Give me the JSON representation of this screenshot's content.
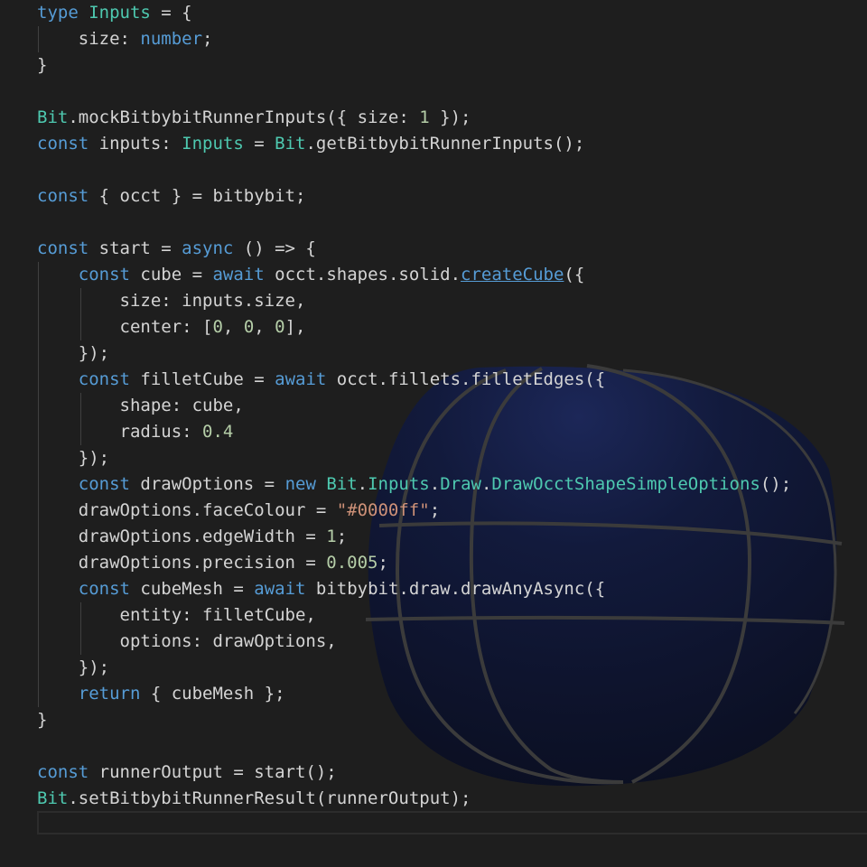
{
  "colors": {
    "background": "#1e1e1e",
    "keyword": "#569cd6",
    "type": "#4ec9b0",
    "number": "#b5cea8",
    "string": "#ce9178",
    "text": "#d4d4d4",
    "indent_guide": "#404040",
    "viewport_sphere": "#0e1330",
    "viewport_edges": "#3b3b3b"
  },
  "viewport": {
    "shape": "fillet-cube-wireframe"
  },
  "code": {
    "lines": [
      [
        [
          "kw",
          "type "
        ],
        [
          "type",
          "Inputs"
        ],
        [
          "plain",
          " = {"
        ]
      ],
      [
        [
          "plain",
          "    size: "
        ],
        [
          "kw",
          "number"
        ],
        [
          "plain",
          ";"
        ]
      ],
      [
        [
          "plain",
          "}"
        ]
      ],
      [],
      [
        [
          "type",
          "Bit"
        ],
        [
          "plain",
          ".mockBitbybitRunnerInputs({ size: "
        ],
        [
          "num",
          "1"
        ],
        [
          "plain",
          " });"
        ]
      ],
      [
        [
          "kw",
          "const "
        ],
        [
          "plain",
          "inputs: "
        ],
        [
          "type",
          "Inputs"
        ],
        [
          "plain",
          " = "
        ],
        [
          "type",
          "Bit"
        ],
        [
          "plain",
          ".getBitbybitRunnerInputs();"
        ]
      ],
      [],
      [
        [
          "kw",
          "const "
        ],
        [
          "plain",
          "{ occt } = bitbybit;"
        ]
      ],
      [],
      [
        [
          "kw",
          "const "
        ],
        [
          "plain",
          "start = "
        ],
        [
          "kw",
          "async"
        ],
        [
          "plain",
          " () => {"
        ]
      ],
      [
        [
          "plain",
          "    "
        ],
        [
          "kw",
          "const "
        ],
        [
          "plain",
          "cube = "
        ],
        [
          "kw",
          "await "
        ],
        [
          "plain",
          "occt.shapes.solid."
        ],
        [
          "link",
          "createCube"
        ],
        [
          "plain",
          "({"
        ]
      ],
      [
        [
          "plain",
          "        size: inputs.size,"
        ]
      ],
      [
        [
          "plain",
          "        center: ["
        ],
        [
          "num",
          "0"
        ],
        [
          "plain",
          ", "
        ],
        [
          "num",
          "0"
        ],
        [
          "plain",
          ", "
        ],
        [
          "num",
          "0"
        ],
        [
          "plain",
          "],"
        ]
      ],
      [
        [
          "plain",
          "    });"
        ]
      ],
      [
        [
          "plain",
          "    "
        ],
        [
          "kw",
          "const "
        ],
        [
          "plain",
          "filletCube = "
        ],
        [
          "kw",
          "await "
        ],
        [
          "plain",
          "occt.fillets.filletEdges({"
        ]
      ],
      [
        [
          "plain",
          "        shape: cube,"
        ]
      ],
      [
        [
          "plain",
          "        radius: "
        ],
        [
          "num",
          "0.4"
        ]
      ],
      [
        [
          "plain",
          "    });"
        ]
      ],
      [
        [
          "plain",
          "    "
        ],
        [
          "kw",
          "const "
        ],
        [
          "plain",
          "drawOptions = "
        ],
        [
          "kw",
          "new "
        ],
        [
          "type",
          "Bit"
        ],
        [
          "plain",
          "."
        ],
        [
          "type",
          "Inputs"
        ],
        [
          "plain",
          "."
        ],
        [
          "type",
          "Draw"
        ],
        [
          "plain",
          "."
        ],
        [
          "type",
          "DrawOcctShapeSimpleOptions"
        ],
        [
          "plain",
          "();"
        ]
      ],
      [
        [
          "plain",
          "    drawOptions.faceColour = "
        ],
        [
          "str",
          "\"#0000ff\""
        ],
        [
          "plain",
          ";"
        ]
      ],
      [
        [
          "plain",
          "    drawOptions.edgeWidth = "
        ],
        [
          "num",
          "1"
        ],
        [
          "plain",
          ";"
        ]
      ],
      [
        [
          "plain",
          "    drawOptions.precision = "
        ],
        [
          "num",
          "0.005"
        ],
        [
          "plain",
          ";"
        ]
      ],
      [
        [
          "plain",
          "    "
        ],
        [
          "kw",
          "const "
        ],
        [
          "plain",
          "cubeMesh = "
        ],
        [
          "kw",
          "await "
        ],
        [
          "plain",
          "bitbybit.draw.drawAnyAsync({"
        ]
      ],
      [
        [
          "plain",
          "        entity: filletCube,"
        ]
      ],
      [
        [
          "plain",
          "        options: drawOptions,"
        ]
      ],
      [
        [
          "plain",
          "    });"
        ]
      ],
      [
        [
          "plain",
          "    "
        ],
        [
          "kw",
          "return "
        ],
        [
          "plain",
          "{ cubeMesh };"
        ]
      ],
      [
        [
          "plain",
          "}"
        ]
      ],
      [],
      [
        [
          "kw",
          "const "
        ],
        [
          "plain",
          "runnerOutput = start();"
        ]
      ],
      [
        [
          "type",
          "Bit"
        ],
        [
          "plain",
          ".setBitbybitRunnerResult(runnerOutput);"
        ]
      ]
    ]
  }
}
